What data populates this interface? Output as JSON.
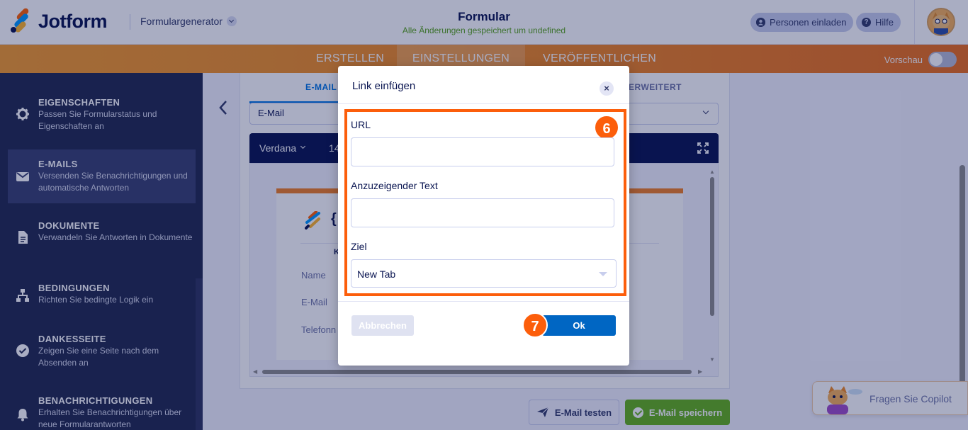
{
  "header": {
    "logo_text": "Jotform",
    "form_generator": "Formulargenerator",
    "title": "Formular",
    "save_status": "Alle Änderungen gespeichert um undefined",
    "invite_label": "Personen einladen",
    "help_label": "Hilfe"
  },
  "nav": {
    "tabs": [
      "ERSTELLEN",
      "EINSTELLUNGEN",
      "VERÖFFENTLICHEN"
    ],
    "active": "EINSTELLUNGEN",
    "preview_label": "Vorschau"
  },
  "sidebar": {
    "items": [
      {
        "title": "EIGENSCHAFTEN",
        "desc": "Passen Sie Formularstatus und Eigenschaften an",
        "icon": "gear-icon"
      },
      {
        "title": "E-MAILS",
        "desc": "Versenden Sie Benachrichtigungen und automatische Antworten",
        "icon": "mail-icon"
      },
      {
        "title": "DOKUMENTE",
        "desc": "Verwandeln Sie Antworten in Dokumente",
        "icon": "document-icon"
      },
      {
        "title": "BEDINGUNGEN",
        "desc": "Richten Sie bedingte Logik ein",
        "icon": "hierarchy-icon"
      },
      {
        "title": "DANKESSEITE",
        "desc": "Zeigen Sie eine Seite nach dem Absenden an",
        "icon": "check-circle-icon"
      },
      {
        "title": "BENACHRICHTIGUNGEN",
        "desc": "Erhalten Sie Benachrichtigungen über neue Formularantworten",
        "icon": "bell-icon"
      }
    ]
  },
  "email_panel": {
    "tab_email": "E-MAIL",
    "tab_advanced": "ERWEITERT",
    "select_value": "E-Mail",
    "font_name": "Verdana",
    "font_size": "14",
    "card_brace": "{",
    "card_k": "K",
    "fields": [
      "Name",
      "E-Mail",
      "Telefonn"
    ],
    "test_button": "E-Mail testen",
    "save_button": "E-Mail speichern"
  },
  "copilot": {
    "label": "Fragen Sie Copilot"
  },
  "modal": {
    "title": "Link einfügen",
    "close": "×",
    "url_label": "URL",
    "url_value": "",
    "text_label": "Anzuzeigender Text",
    "text_value": "",
    "target_label": "Ziel",
    "target_value": "New Tab",
    "cancel_label": "Abbrechen",
    "ok_label": "Ok",
    "step_6": "6",
    "step_7": "7"
  },
  "colors": {
    "brand_orange": "#fc5e0b",
    "nav_orange": "#f08a24",
    "sidebar_bg": "#222a4f",
    "ok_blue": "#0066c3",
    "save_green": "#64b21b"
  }
}
